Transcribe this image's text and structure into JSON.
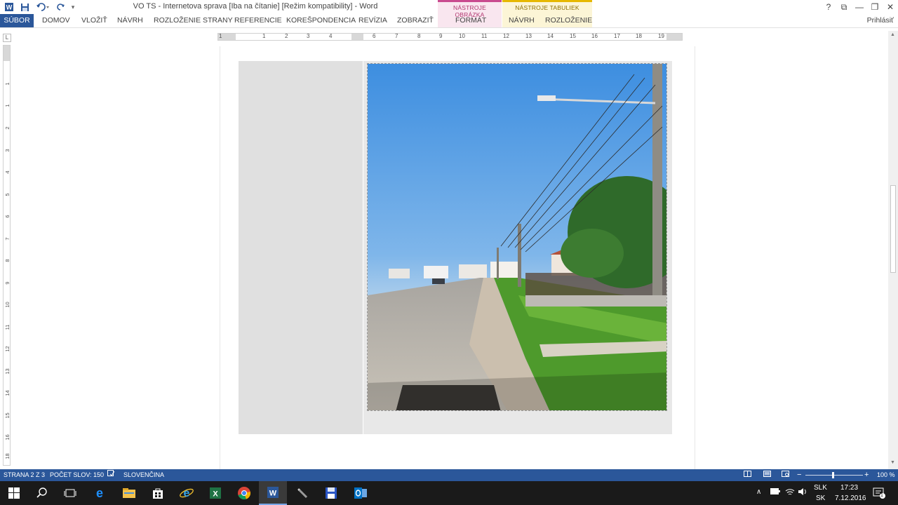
{
  "titlebar": {
    "title": "VO TS - Internetova sprava [Iba na čítanie] [Režim kompatibility] - Word",
    "quick_access": {
      "app_icon": "word-app-icon",
      "save_icon": "save-icon",
      "undo_icon": "undo-icon",
      "redo_icon": "redo-icon",
      "customize_icon": "customize-qat-icon"
    },
    "controls": {
      "help": "?",
      "ribbon_display": "⧉",
      "minimize": "—",
      "restore": "❐",
      "close": "✕"
    }
  },
  "context_groups": {
    "picture_tools": {
      "label": "NÁSTROJE OBRÁZKA",
      "color": "#c94a8f"
    },
    "table_tools": {
      "label": "NÁSTROJE TABULIEK",
      "color": "#e6b800"
    }
  },
  "ribbon": {
    "tabs": [
      {
        "label": "SÚBOR"
      },
      {
        "label": "DOMOV"
      },
      {
        "label": "VLOŽIŤ"
      },
      {
        "label": "NÁVRH"
      },
      {
        "label": "ROZLOŽENIE STRANY"
      },
      {
        "label": "REFERENCIE"
      },
      {
        "label": "KOREŠPONDENCIA"
      },
      {
        "label": "REVÍZIA"
      },
      {
        "label": "ZOBRAZIŤ"
      },
      {
        "label": "FORMÁT"
      },
      {
        "label": "NÁVRH"
      },
      {
        "label": "ROZLOŽENIE"
      }
    ],
    "signin": "Prihlásiť",
    "accent": "#2b579a"
  },
  "ruler": {
    "corner_label": "L",
    "h_numbers": [
      "1",
      "1",
      "2",
      "3",
      "4",
      "6",
      "7",
      "8",
      "9",
      "10",
      "11",
      "12",
      "13",
      "14",
      "15",
      "16",
      "17",
      "18",
      "19"
    ],
    "v_numbers": [
      "1",
      "1",
      "2",
      "3",
      "4",
      "5",
      "6",
      "7",
      "8",
      "9",
      "10",
      "11",
      "12",
      "13",
      "14",
      "15",
      "16",
      "1",
      "18"
    ]
  },
  "document": {
    "image_description_icon": "street-photo"
  },
  "statusbar": {
    "page": "STRANA 2 Z 3",
    "words": "POČET SLOV: 150",
    "proofing_icon": "proofing-icon",
    "language": "SLOVENČINA",
    "zoom": "100 %",
    "zoom_minus": "−",
    "zoom_plus": "+",
    "zoom_level": 1.0
  },
  "taskbar": {
    "apps": [
      {
        "name": "start-icon"
      },
      {
        "name": "search-icon"
      },
      {
        "name": "task-view-icon"
      },
      {
        "name": "edge-icon"
      },
      {
        "name": "file-explorer-icon"
      },
      {
        "name": "store-icon"
      },
      {
        "name": "internet-explorer-icon"
      },
      {
        "name": "excel-icon"
      },
      {
        "name": "chrome-icon"
      },
      {
        "name": "word-icon"
      },
      {
        "name": "tool-icon"
      },
      {
        "name": "floppy-icon"
      },
      {
        "name": "outlook-icon"
      }
    ],
    "tray": {
      "lang_top": "SLK",
      "lang_bottom": "SK",
      "time": "17:23",
      "date": "7.12.2016",
      "notifications": "1"
    }
  }
}
